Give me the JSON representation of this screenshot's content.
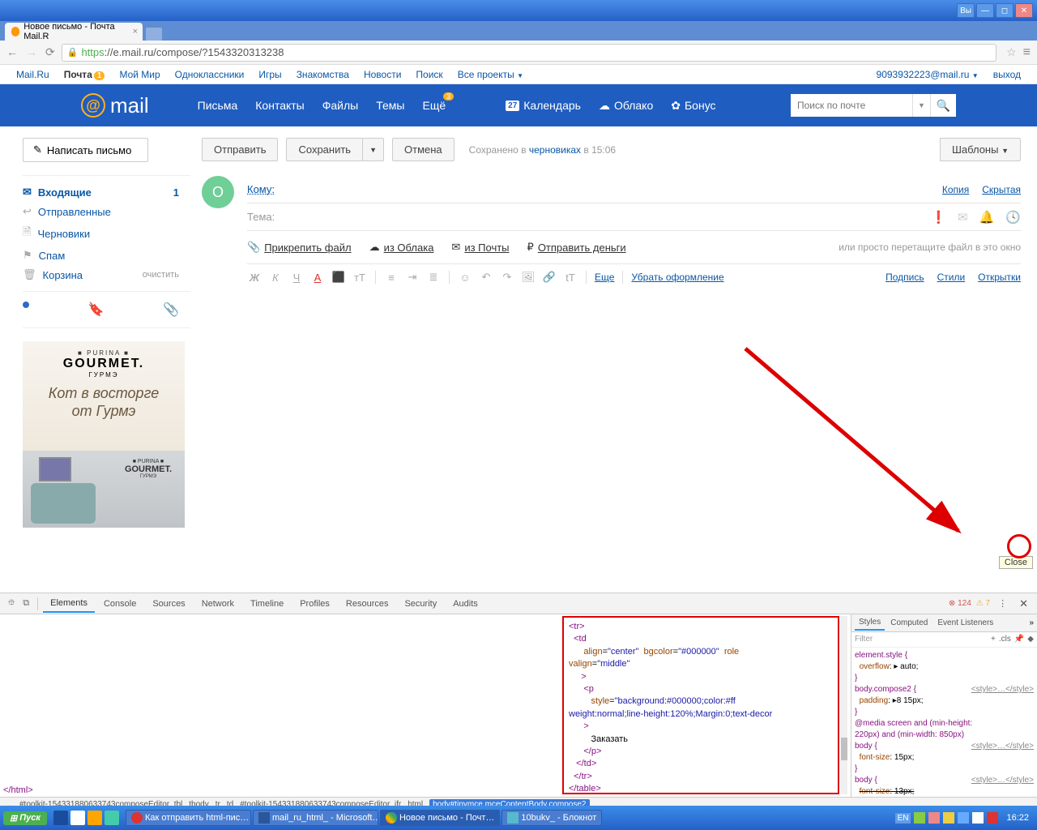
{
  "window": {
    "lang_btn": "Вы"
  },
  "browser": {
    "tab_title": "Новое письмо - Почта Mail.R",
    "url_https": "https",
    "url_rest": "://e.mail.ru/compose/?1543320313238"
  },
  "topnav": {
    "items": [
      "Mail.Ru",
      "Почта",
      "Мой Мир",
      "Одноклассники",
      "Игры",
      "Знакомства",
      "Новости",
      "Поиск",
      "Все проекты"
    ],
    "mail_badge": "1",
    "user_email": "9093932223@mail.ru",
    "logout": "выход"
  },
  "header": {
    "logo": "mail",
    "nav": [
      "Письма",
      "Контакты",
      "Файлы",
      "Темы",
      "Ещё"
    ],
    "more_badge": "3",
    "extras": [
      {
        "icon": "calendar",
        "label": "Календарь",
        "day": "27"
      },
      {
        "icon": "cloud",
        "label": "Облако"
      },
      {
        "icon": "bonus",
        "label": "Бонус"
      }
    ],
    "search_placeholder": "Поиск по почте"
  },
  "sidebar": {
    "compose": "Написать письмо",
    "folders": [
      {
        "icon": "✉",
        "label": "Входящие",
        "count": "1",
        "active": true
      },
      {
        "icon": "↩",
        "label": "Отправленные"
      },
      {
        "icon": "🗎",
        "label": "Черновики"
      },
      {
        "icon": "⚑",
        "label": "Спам"
      },
      {
        "icon": "🗑",
        "label": "Корзина",
        "clear": "очистить"
      }
    ],
    "ad": {
      "purina": "■ PURINA ■",
      "brand": "GOURMET.",
      "gurme": "ГУРМЭ",
      "slogan1": "Кот в восторге",
      "slogan2": "от Гурмэ"
    }
  },
  "actions": {
    "send": "Отправить",
    "save": "Сохранить",
    "cancel": "Отмена",
    "saved_prefix": "Сохранено в ",
    "saved_link": "черновиках",
    "saved_time": " в 15:06",
    "templates": "Шаблоны"
  },
  "compose": {
    "avatar": "О",
    "to_label": "Кому:",
    "copy": "Копия",
    "bcc": "Скрытая",
    "subject_label": "Тема:",
    "attach": "Прикрепить файл",
    "from_cloud": "из Облака",
    "from_mail": "из Почты",
    "send_money": "Отправить деньги",
    "drag_hint": "или просто перетащите файл в это окно",
    "more": "Еще",
    "remove_fmt": "Убрать оформление",
    "signature": "Подпись",
    "styles": "Стили",
    "cards": "Открытки"
  },
  "devtools": {
    "tabs": [
      "Elements",
      "Console",
      "Sources",
      "Network",
      "Timeline",
      "Profiles",
      "Resources",
      "Security",
      "Audits"
    ],
    "errors": "124",
    "warnings": "7",
    "close_tooltip": "Close",
    "styles_tabs": [
      "Styles",
      "Computed",
      "Event Listeners"
    ],
    "filter": "Filter",
    "cls": ".cls",
    "breadcrumb": [
      "…",
      "#toolkit-154331880633743composeEditor_tbl",
      "tbody",
      "tr",
      "td",
      "#toolkit-154331880633743composeEditor_ifr",
      "html"
    ],
    "breadcrumb_active": "body#tinymce.mceContentBody.compose2",
    "css_rules": [
      {
        "selector": "element.style {",
        "props": [
          {
            "n": "overflow",
            "v": "▸ auto;"
          }
        ],
        "close": "}"
      },
      {
        "selector": "body.compose2 {",
        "src": "<style>…</style>",
        "props": [
          {
            "n": "padding",
            "v": "▸8 15px;"
          }
        ],
        "close": "}"
      },
      {
        "selector": "@media screen and (min-height: 220px) and (min-width: 850px)",
        "props": []
      },
      {
        "selector": "body {",
        "src": "<style>…</style>",
        "props": [
          {
            "n": "font-size",
            "v": "15px;"
          }
        ],
        "close": "}"
      },
      {
        "selector": "body {",
        "src": "<style>…</style>",
        "props": [
          {
            "n": "font-size",
            "v": "13px;",
            "struck": true
          }
        ],
        "close": ""
      }
    ]
  },
  "taskbar": {
    "start": "Пуск",
    "tasks": [
      "Как отправить html-пис…",
      "mail_ru_html_ - Microsoft…",
      "Новое письмо - Почт…",
      "10bukv_ - Блокнот"
    ],
    "lang": "EN",
    "time": "16:22"
  }
}
